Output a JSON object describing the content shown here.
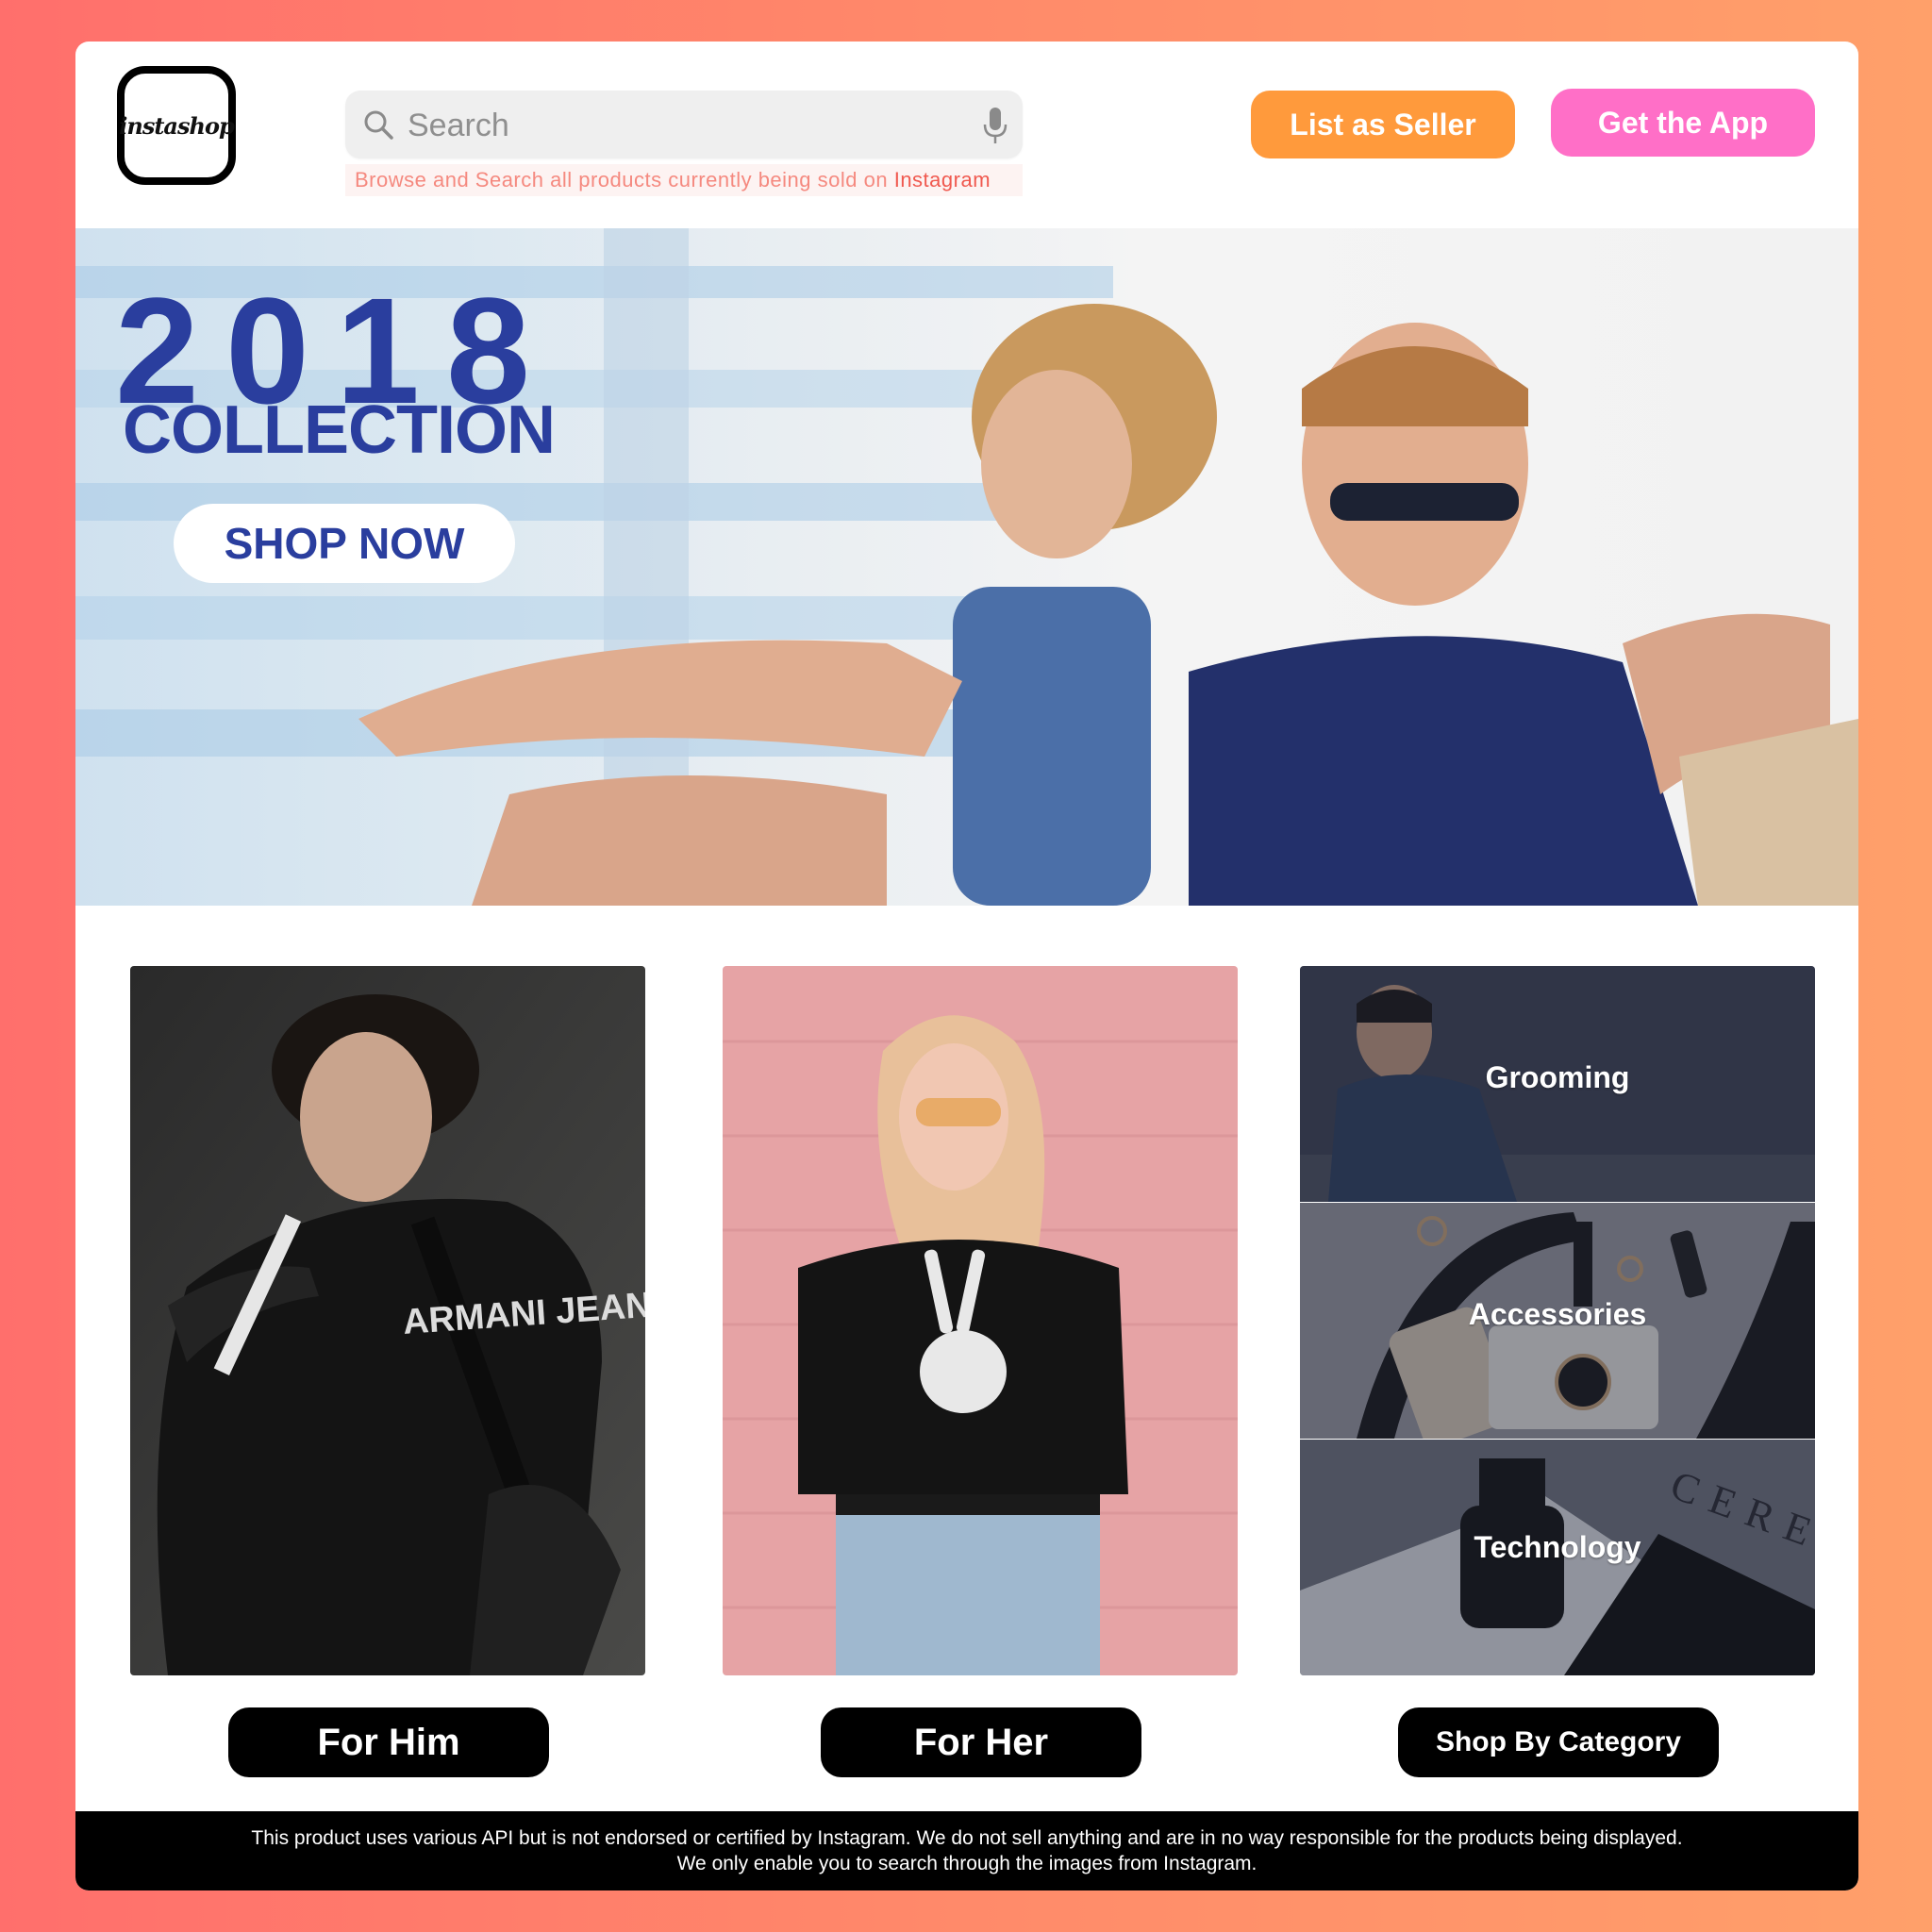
{
  "header": {
    "logo_text": "instashop",
    "search": {
      "placeholder": "Search",
      "hint_prefix": "Browse and Search all products currently being sold on",
      "hint_brand": "Instagram"
    },
    "seller_button": "List as Seller",
    "app_button": "Get the App"
  },
  "hero": {
    "year": "2018",
    "subtitle": "COLLECTION",
    "cta": "SHOP NOW"
  },
  "tiles": {
    "him": {
      "label": "For Him"
    },
    "her": {
      "label": "For Her"
    },
    "category": {
      "label": "Shop By Category",
      "items": [
        {
          "label": "Grooming"
        },
        {
          "label": "Accessories"
        },
        {
          "label": "Technology"
        }
      ]
    }
  },
  "footer": {
    "line1": "This product uses various API but is not endorsed or certified by Instagram. We do not sell anything and are in no way responsible for the products being displayed.",
    "line2": "We only enable you to search through the images from Instagram."
  },
  "colors": {
    "brand_blue": "#2a3e9e",
    "seller_orange": "#ff9a3c",
    "app_pink": "#ff6fc7",
    "hint_red": "#f0594f"
  },
  "icons": [
    "search-icon",
    "mic-icon"
  ]
}
